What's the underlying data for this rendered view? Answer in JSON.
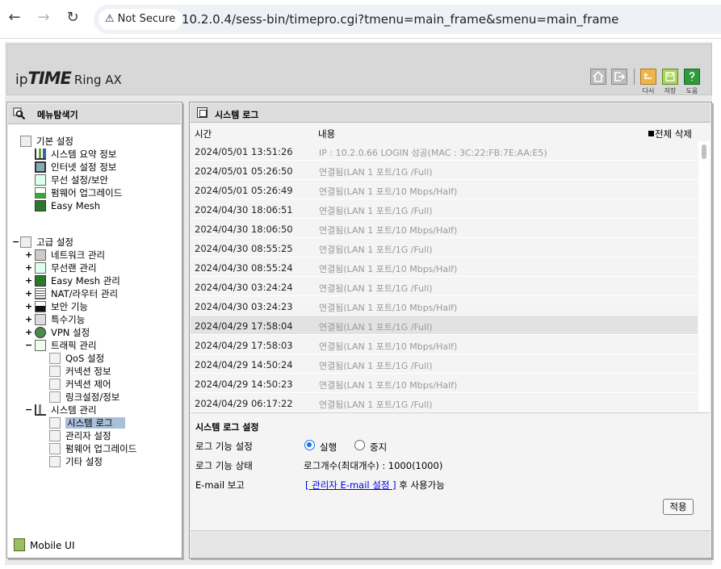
{
  "browser": {
    "back_icon": "←",
    "forward_icon": "→",
    "reload_icon": "↻",
    "security_label": "Not Secure",
    "url": "10.2.0.4/sess-bin/timepro.cgi?tmenu=main_frame&smenu=main_frame"
  },
  "brand": {
    "ip": "ip",
    "time": "TIME",
    "model": "Ring AX"
  },
  "toolbar": {
    "restart_label": "다시",
    "save_label": "저장",
    "help_label": "도움"
  },
  "menu": {
    "title": "메뉴탐색기",
    "basic": {
      "label": "기본 설정",
      "items": [
        "시스템 요약 정보",
        "인터넷 설정 정보",
        "무선 설정/보안",
        "펌웨어 업그레이드",
        "Easy Mesh"
      ]
    },
    "advanced": {
      "label": "고급 설정",
      "items": [
        "네트워크 관리",
        "무선랜 관리",
        "Easy Mesh 관리",
        "NAT/라우터 관리",
        "보안 기능",
        "특수기능",
        "VPN 설정",
        "트래픽 관리"
      ],
      "traffic_children": [
        "QoS 설정",
        "커넥션 정보",
        "커넥션 제어",
        "링크설정/정보"
      ],
      "system_label": "시스템 관리",
      "system_children": [
        "시스템 로그",
        "관리자 설정",
        "펌웨어 업그레이드",
        "기타 설정"
      ]
    },
    "mobile_ui": "Mobile UI"
  },
  "main": {
    "title": "시스템 로그",
    "col_time": "시간",
    "col_content": "내용",
    "delete_all": "전체 삭제",
    "logs": [
      {
        "time": "2024/05/01 13:51:26",
        "content": "IP : 10.2.0.66 LOGIN 성공(MAC : 3C:22:FB:7E:AA:E5)"
      },
      {
        "time": "2024/05/01 05:26:50",
        "content": "연결됨(LAN 1 포트/1G /Full)"
      },
      {
        "time": "2024/05/01 05:26:49",
        "content": "연결됨(LAN 1 포트/10 Mbps/Half)"
      },
      {
        "time": "2024/04/30 18:06:51",
        "content": "연결됨(LAN 1 포트/1G /Full)"
      },
      {
        "time": "2024/04/30 18:06:50",
        "content": "연결됨(LAN 1 포트/10 Mbps/Half)"
      },
      {
        "time": "2024/04/30 08:55:25",
        "content": "연결됨(LAN 1 포트/1G /Full)"
      },
      {
        "time": "2024/04/30 08:55:24",
        "content": "연결됨(LAN 1 포트/10 Mbps/Half)"
      },
      {
        "time": "2024/04/30 03:24:24",
        "content": "연결됨(LAN 1 포트/1G /Full)"
      },
      {
        "time": "2024/04/30 03:24:23",
        "content": "연결됨(LAN 1 포트/10 Mbps/Half)"
      },
      {
        "time": "2024/04/29 17:58:04",
        "content": "연결됨(LAN 1 포트/1G /Full)"
      },
      {
        "time": "2024/04/29 17:58:03",
        "content": "연결됨(LAN 1 포트/10 Mbps/Half)"
      },
      {
        "time": "2024/04/29 14:50:24",
        "content": "연결됨(LAN 1 포트/1G /Full)"
      },
      {
        "time": "2024/04/29 14:50:23",
        "content": "연결됨(LAN 1 포트/10 Mbps/Half)"
      },
      {
        "time": "2024/04/29 06:17:22",
        "content": "연결됨(LAN 1 포트/1G /Full)"
      }
    ],
    "settings": {
      "title": "시스템 로그 설정",
      "log_function_label": "로그 기능 설정",
      "opt_run": "실행",
      "opt_stop": "중지",
      "selected": "실행",
      "log_status_label": "로그 기능 상태",
      "log_status_value": "로그개수(최대개수) : 1000(1000)",
      "email_label": "E-mail 보고",
      "email_link": "[ 관리자 E-mail 설정 ]",
      "email_suffix": " 후 사용가능",
      "apply_label": "적용"
    }
  }
}
